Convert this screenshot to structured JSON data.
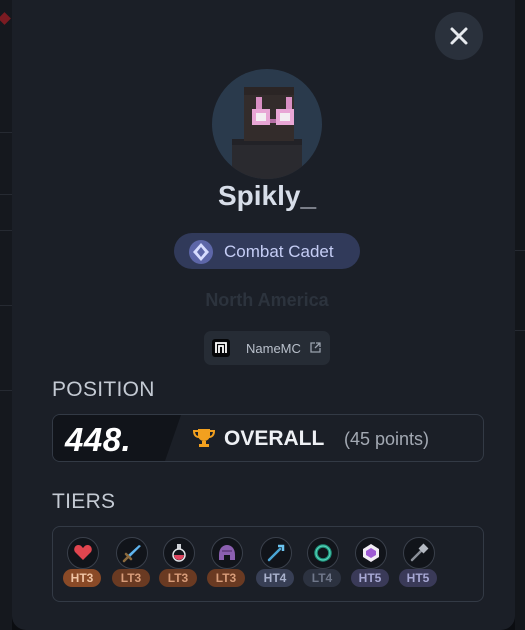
{
  "player": {
    "name": "Spikly_",
    "rank_title": "Combat Cadet",
    "region": "North America",
    "namemc_label": "NameMC"
  },
  "position": {
    "section_title": "POSITION",
    "number": "448.",
    "overall_label": "OVERALL",
    "points_text": "(45 points)"
  },
  "tiers": {
    "section_title": "TIERS",
    "items": [
      {
        "icon": "heart-icon",
        "tier": "HT3"
      },
      {
        "icon": "sword-icon",
        "tier": "LT3"
      },
      {
        "icon": "potion-icon",
        "tier": "LT3"
      },
      {
        "icon": "helmet-icon",
        "tier": "LT3"
      },
      {
        "icon": "trident-icon",
        "tier": "HT4"
      },
      {
        "icon": "ring-icon",
        "tier": "LT4"
      },
      {
        "icon": "crystal-icon",
        "tier": "HT5"
      },
      {
        "icon": "mace-icon",
        "tier": "HT5"
      }
    ]
  },
  "colors": {
    "modal_bg": "#1b1f27",
    "rank_badge_bg": "#313a5a",
    "trophy": "#f2a01f",
    "ht3": "#8a4a27",
    "lt3": "#6a3a22"
  }
}
